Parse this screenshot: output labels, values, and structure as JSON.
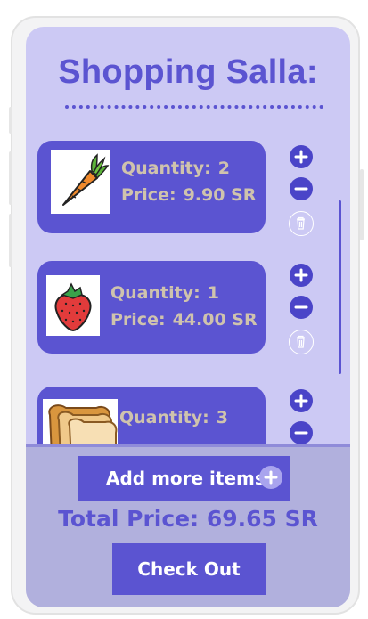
{
  "app": {
    "title": "Shopping Salla:"
  },
  "items": [
    {
      "product_icon": "carrot-icon",
      "quantity_label": "Quantity:",
      "quantity": "2",
      "price_label": "Price:",
      "price": "9.90 SR"
    },
    {
      "product_icon": "strawberry-icon",
      "quantity_label": "Quantity:",
      "quantity": "1",
      "price_label": "Price:",
      "price": "44.00 SR"
    },
    {
      "product_icon": "bread-icon",
      "quantity_label": "Quantity:",
      "quantity": "3"
    }
  ],
  "footer": {
    "add_label": "Add more items",
    "total_text": "Total Price: 69.65 SR",
    "checkout_label": "Check Out"
  },
  "colors": {
    "accent": "#5b54d1",
    "screen_background": "#ccc9f4",
    "footer_background": "#b1b0dd",
    "item_text": "#cfc3ad"
  },
  "icons": [
    "plus-icon",
    "minus-icon",
    "trash-icon",
    "add-circle-icon"
  ]
}
